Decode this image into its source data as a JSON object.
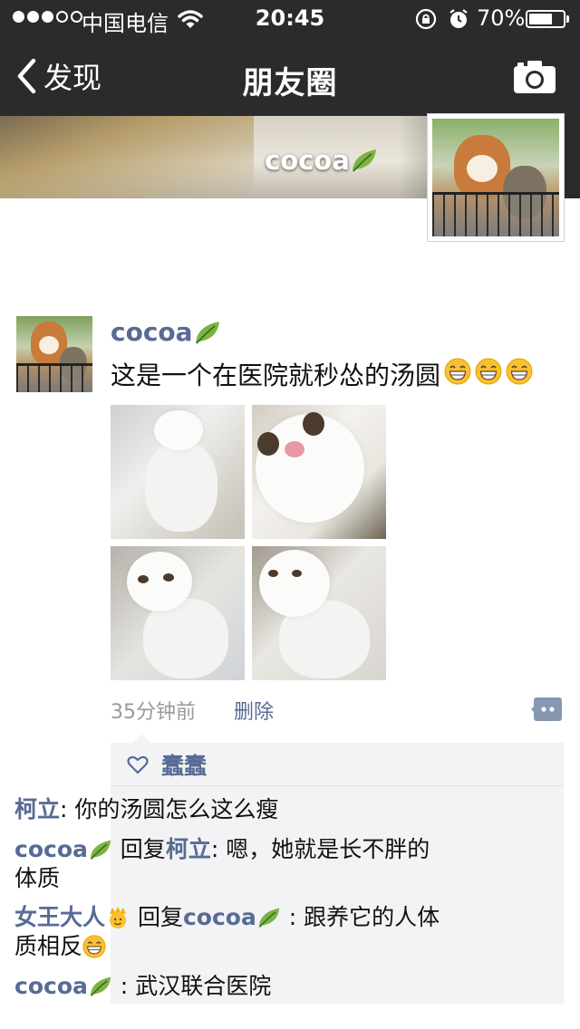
{
  "status_bar": {
    "carrier": "中国电信",
    "time": "20:45",
    "battery": "70%",
    "battery_level": 0.7,
    "signal_bars_filled": 3,
    "signal_bars_total": 5
  },
  "nav": {
    "back_label": "发现",
    "title": "朋友圈",
    "camera_icon": "camera-icon"
  },
  "cover": {
    "username": "cocoa"
  },
  "post": {
    "author": "cocoa",
    "text": "这是一个在医院就秒怂的汤圆",
    "emoji_count": 3,
    "photo_count": 4,
    "time": "35分钟前",
    "delete_label": "删除"
  },
  "likes": {
    "names": "蠢蠢"
  },
  "comments": [
    {
      "author": "柯立",
      "separator": ": ",
      "text": "你的汤圆怎么这么瘦"
    },
    {
      "author": "cocoa",
      "reply_word": " 回复",
      "reply_to": "柯立",
      "separator": ": ",
      "text": "嗯，她就是长不胖的体质"
    },
    {
      "author": "女王大人",
      "reply_word": " 回复",
      "reply_to": "cocoa",
      "separator": " : ",
      "text": "跟养它的人体质相反"
    },
    {
      "author": "cocoa",
      "separator": " : ",
      "text": "武汉联合医院"
    }
  ],
  "colors": {
    "nav_bg": "#2b2b2d",
    "link": "#576b95",
    "comment_bg": "#f3f3f5",
    "meta_text": "#9a9a9a"
  },
  "icons": [
    "back-chevron-icon",
    "camera-icon",
    "wifi-icon",
    "rotation-lock-icon",
    "alarm-icon",
    "battery-icon",
    "leaf-icon",
    "grin-emoji-icon",
    "comment-action-icon",
    "heart-icon",
    "crown-emoji-icon"
  ]
}
